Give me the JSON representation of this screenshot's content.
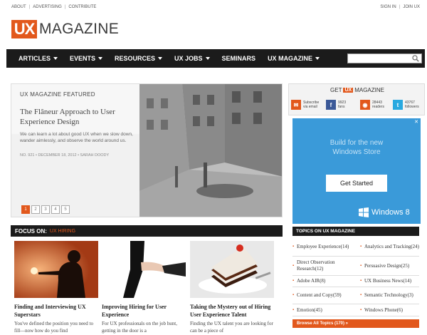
{
  "util": {
    "left_links": [
      "ABOUT",
      "ADVERTISING",
      "CONTRIBUTE"
    ],
    "right_links": [
      "SIGN IN",
      "JOIN UX"
    ]
  },
  "logo": {
    "ux": "UX",
    "magazine": "MAGAZINE"
  },
  "nav": {
    "items": [
      {
        "label": "ARTICLES",
        "dropdown": true
      },
      {
        "label": "EVENTS",
        "dropdown": true
      },
      {
        "label": "RESOURCES",
        "dropdown": true
      },
      {
        "label": "UX JOBS",
        "dropdown": true
      },
      {
        "label": "SEMINARS",
        "dropdown": false
      },
      {
        "label": "UX MAGAZINE",
        "dropdown": true
      }
    ],
    "search_placeholder": ""
  },
  "featured": {
    "label": "UX MAGAZINE FEATURED",
    "title": "The Flâneur Approach to User Experience Design",
    "description": "We can learn a lot about good UX when we slow down, wander aimlessly, and observe the world around us.",
    "meta": "NO. 921 • DECEMBER 18, 2012 • SARAH DOODY",
    "pages": [
      "1",
      "2",
      "3",
      "4",
      "5"
    ],
    "active_page": "1"
  },
  "focus": {
    "label": "FOCUS ON:",
    "topic": "UX HIRING",
    "cards": [
      {
        "title": "Finding and Interviewing UX Superstars",
        "desc": "You've defined the position you need to fill—now how do you find"
      },
      {
        "title": "Improving Hiring for User Experience",
        "desc": "For UX professionals on the job hunt, getting in the door is a"
      },
      {
        "title": "Taking the Mystery out of Hiring User Experience Talent",
        "desc": "Finding the UX talent you are looking for can be a piece of"
      }
    ]
  },
  "get": {
    "prefix": "GET",
    "ux": "UX",
    "suffix": "MAGAZINE",
    "social": [
      {
        "icon": "email-icon",
        "line1": "Subscribe",
        "line2": "via email",
        "color": "#e2581c"
      },
      {
        "icon": "facebook-icon",
        "line1": "9923",
        "line2": "fans",
        "color": "#3b5998"
      },
      {
        "icon": "rss-icon",
        "line1": "28443",
        "line2": "readers",
        "color": "#e2581c"
      },
      {
        "icon": "twitter-icon",
        "line1": "43767",
        "line2": "followers",
        "color": "#29a9e0"
      }
    ]
  },
  "ad": {
    "close": "✕",
    "line1": "Build for the new",
    "line2": "Windows Store",
    "button": "Get Started",
    "brand": "Windows 8",
    "color": "#3a9ad9"
  },
  "topics": {
    "heading": "TOPICS ON UX MAGAZINE",
    "items": [
      "Employee Experience(14)",
      "Analytics and Tracking(24)",
      "Direct Observation Research(12)",
      "Persuasive Design(25)",
      "Adobe AIR(8)",
      "UX Business News(14)",
      "Content and Copy(59)",
      "Semantic Technology(3)",
      "Emotion(45)",
      "Windows Phone(6)"
    ],
    "browse": "Browse All Topics (170) »"
  },
  "colors": {
    "accent": "#e2581c",
    "nav_bg": "#1b1b1b"
  }
}
